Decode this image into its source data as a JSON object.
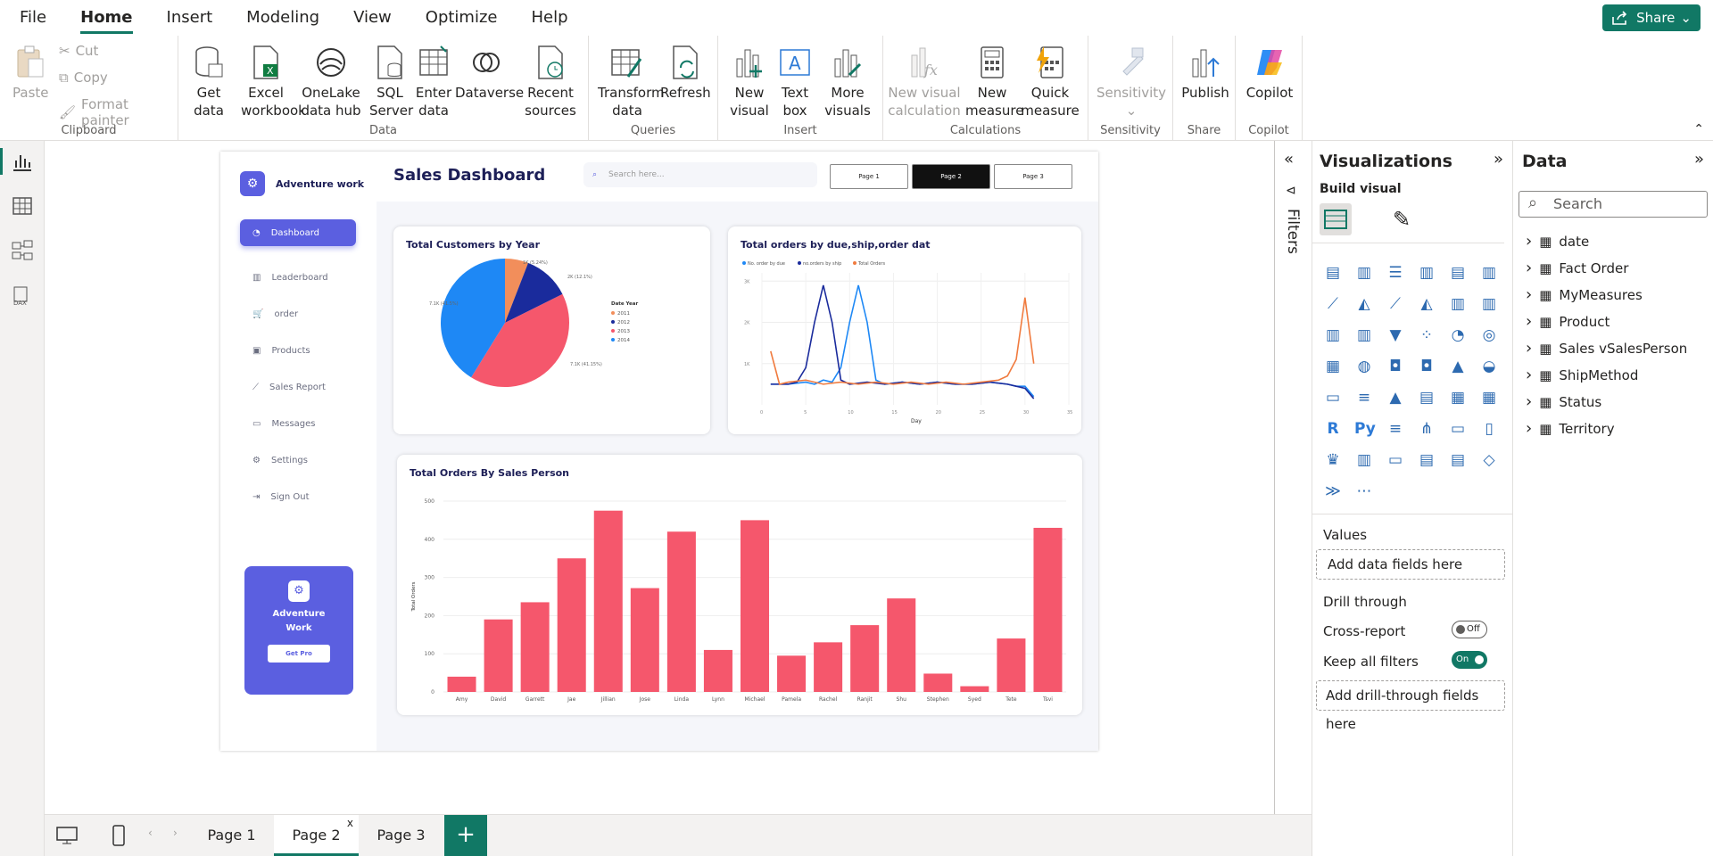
{
  "menu": {
    "items": [
      "File",
      "Home",
      "Insert",
      "Modeling",
      "View",
      "Optimize",
      "Help"
    ],
    "active": "Home",
    "share": "Share"
  },
  "ribbon": {
    "clipboard": {
      "paste": "Paste",
      "cut": "Cut",
      "copy": "Copy",
      "format_painter": "Format painter",
      "label": "Clipboard"
    },
    "data": {
      "get_data": "Get data",
      "excel": "Excel workbook",
      "onelake": "OneLake data hub",
      "sql": "SQL Server",
      "enter": "Enter data",
      "dataverse": "Dataverse",
      "recent": "Recent sources",
      "label": "Data"
    },
    "queries": {
      "transform": "Transform data",
      "refresh": "Refresh",
      "label": "Queries"
    },
    "insert": {
      "new_visual": "New visual",
      "text_box": "Text box",
      "more_visuals": "More visuals",
      "label": "Insert"
    },
    "calculations": {
      "new_visual_calc": "New visual calculation",
      "new_measure": "New measure",
      "quick_measure": "Quick measure",
      "label": "Calculations"
    },
    "sensitivity": {
      "btn": "Sensitivity",
      "label": "Sensitivity"
    },
    "share": {
      "publish": "Publish",
      "label": "Share"
    },
    "copilot": {
      "btn": "Copilot",
      "label": "Copilot"
    }
  },
  "report": {
    "brand": "Adventure work",
    "title": "Sales Dashboard",
    "search_placeholder": "Search here...",
    "page_buttons": [
      "Page 1",
      "Page 2",
      "Page 3"
    ],
    "nav": [
      "Dashboard",
      "Leaderboard",
      "order",
      "Products",
      "Sales Report",
      "Messages",
      "Settings",
      "Sign Out"
    ],
    "promo": {
      "line1": "Adventure",
      "line2": "Work",
      "button": "Get Pro"
    },
    "colors": {
      "accent": "#5b5fe0",
      "bar": "#f5576c"
    }
  },
  "chart_data": [
    {
      "type": "pie",
      "title": "Total Customers by Year",
      "legend_title": "Date Year",
      "labels": [
        "2011",
        "2012",
        "2013",
        "2014"
      ],
      "values": [
        1,
        2,
        7,
        7
      ],
      "data_labels": [
        "1K (5.24%)",
        "2K (12.1%)",
        "7.1K (41.15%)",
        "7.1K (41.5%)"
      ],
      "colors": [
        "#f28e5b",
        "#1a2b9c",
        "#f5576c",
        "#1e88f5"
      ]
    },
    {
      "type": "line",
      "title": "Total orders by due,ship,order dat",
      "xlabel": "Day",
      "x_ticks": [
        "0",
        "5",
        "10",
        "15",
        "20",
        "25",
        "30",
        "35"
      ],
      "y_ticks": [
        "1K",
        "2K",
        "3K"
      ],
      "series": [
        {
          "name": "No. order by due",
          "color": "#1e88f5",
          "x": [
            1,
            3,
            5,
            6,
            7,
            8,
            9,
            10,
            11,
            12,
            13,
            14,
            16,
            18,
            20,
            22,
            24,
            26,
            28,
            29,
            30,
            31
          ],
          "y": [
            0.5,
            0.5,
            0.55,
            0.5,
            0.6,
            0.55,
            0.9,
            2.0,
            2.9,
            2.0,
            0.6,
            0.5,
            0.55,
            0.5,
            0.55,
            0.5,
            0.5,
            0.55,
            0.5,
            0.45,
            0.45,
            0.2
          ]
        },
        {
          "name": "no.orders by ship",
          "color": "#1a2b9c",
          "x": [
            1,
            3,
            4,
            5,
            6,
            7,
            8,
            9,
            10,
            12,
            14,
            16,
            18,
            20,
            22,
            24,
            26,
            28,
            29,
            30,
            31
          ],
          "y": [
            0.5,
            0.5,
            0.55,
            0.9,
            2.0,
            2.9,
            2.0,
            0.6,
            0.5,
            0.55,
            0.5,
            0.55,
            0.5,
            0.55,
            0.5,
            0.5,
            0.55,
            0.5,
            0.45,
            0.4,
            0.15
          ]
        },
        {
          "name": "Total Orders",
          "color": "#f07b3f",
          "x": [
            1,
            2,
            3,
            5,
            7,
            9,
            11,
            13,
            15,
            17,
            19,
            21,
            23,
            25,
            27,
            28,
            29,
            30,
            31
          ],
          "y": [
            1.3,
            0.5,
            0.55,
            0.6,
            0.5,
            0.55,
            0.5,
            0.55,
            0.5,
            0.55,
            0.5,
            0.55,
            0.5,
            0.55,
            0.6,
            0.7,
            1.1,
            2.6,
            1.0
          ]
        }
      ]
    },
    {
      "type": "bar",
      "title": "Total Orders  By Sales Person",
      "ylabel": "Total Orders",
      "ylim": [
        0,
        500
      ],
      "y_ticks": [
        0,
        100,
        200,
        300,
        400,
        500
      ],
      "categories": [
        "Amy",
        "David",
        "Garrett",
        "Jae",
        "Jillian",
        "Jose",
        "Linda",
        "Lynn",
        "Michael",
        "Pamela",
        "Rachel",
        "Ranjit",
        "Shu",
        "Stephen",
        "Syed",
        "Tete",
        "Tsvi"
      ],
      "values": [
        40,
        190,
        235,
        350,
        475,
        272,
        420,
        110,
        450,
        95,
        130,
        175,
        245,
        48,
        15,
        140,
        430
      ]
    }
  ],
  "filters_label": "Filters",
  "viz": {
    "title": "Visualizations",
    "build": "Build visual",
    "values": "Values",
    "add_fields": "Add data fields here",
    "drill": "Drill through",
    "cross": "Cross-report",
    "cross_state": "Off",
    "keep": "Keep all filters",
    "keep_state": "On",
    "add_drill": "Add drill-through fields here"
  },
  "data_pane": {
    "title": "Data",
    "search": "Search",
    "fields": [
      "date",
      "Fact Order",
      "MyMeasures",
      "Product",
      "Sales vSalesPerson",
      "ShipMethod",
      "Status",
      "Territory"
    ]
  },
  "pages": {
    "tabs": [
      "Page 1",
      "Page 2",
      "Page 3"
    ],
    "active": "Page 2",
    "close": "x",
    "add": "+"
  }
}
